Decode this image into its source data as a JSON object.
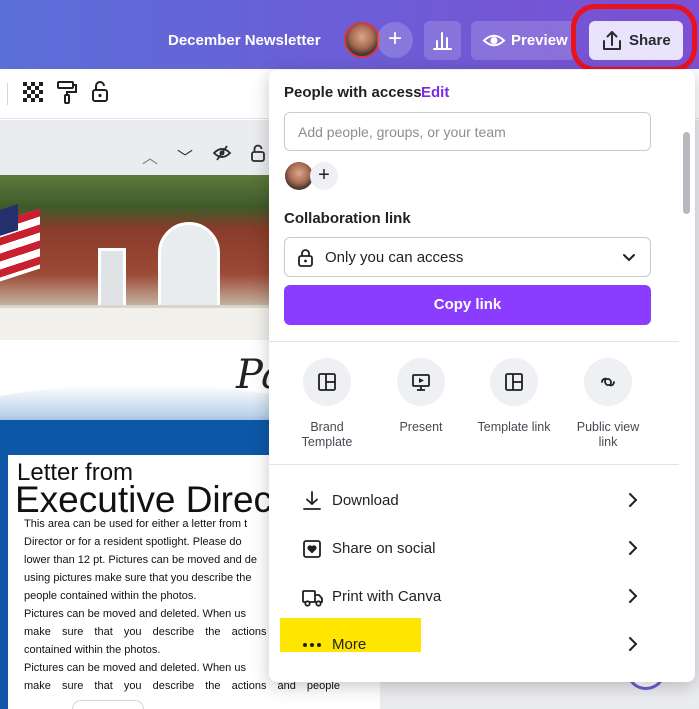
{
  "header": {
    "title": "December Newsletter",
    "preview_label": "Preview",
    "share_label": "Share"
  },
  "canvas": {
    "script_heading": "Pa",
    "letter_from": "Letter from",
    "exec_director": "Executive Direc",
    "body_lines": [
      "This area can be used for either a letter from t",
      "Director or for a resident spotlight. Please do",
      "lower than 12 pt. Pictures can be moved and de",
      "using pictures make sure that you describe the",
      "people contained within the photos.",
      "Pictures can be moved and deleted. When us",
      "make sure that you describe the actions",
      "contained within the photos.",
      "Pictures can be moved and deleted. When us",
      "make sure that you describe the actions and people"
    ]
  },
  "share_panel": {
    "people_label": "People with access",
    "edit_label": "Edit",
    "add_placeholder": "Add people, groups, or your team",
    "collab_label": "Collaboration link",
    "access_value": "Only you can access",
    "copy_link_label": "Copy link",
    "tiles": [
      {
        "label": "Brand Template",
        "icon": "brand-template-icon"
      },
      {
        "label": "Present",
        "icon": "present-icon"
      },
      {
        "label": "Template link",
        "icon": "template-link-icon"
      },
      {
        "label": "Public view link",
        "icon": "public-view-link-icon"
      }
    ],
    "rows": [
      {
        "label": "Download",
        "icon": "download-icon"
      },
      {
        "label": "Share on social",
        "icon": "heart-icon"
      },
      {
        "label": "Print with Canva",
        "icon": "truck-icon"
      },
      {
        "label": "More",
        "icon": "more-dots-icon"
      }
    ]
  },
  "colors": {
    "accent": "#8b3dff",
    "edit_link": "#7d2ae8",
    "annotation_red": "#e8131f",
    "annotation_yellow": "#ffe600"
  }
}
